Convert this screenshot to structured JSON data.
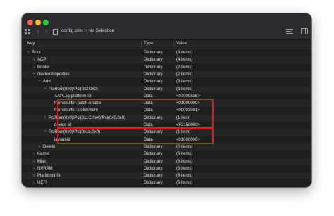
{
  "toolbar": {
    "filename": "config.plist",
    "separator": ">",
    "selection": "No Selection"
  },
  "columns": {
    "key": "Key",
    "type": "Type",
    "value": "Value"
  },
  "rows": [
    {
      "key": "Root",
      "type": "Dictionary",
      "value": "(8 items)",
      "depth": 0,
      "disclosure": "open"
    },
    {
      "key": "ACPI",
      "type": "Dictionary",
      "value": "(4 items)",
      "depth": 1,
      "disclosure": "closed"
    },
    {
      "key": "Booter",
      "type": "Dictionary",
      "value": "(2 items)",
      "depth": 1,
      "disclosure": "closed"
    },
    {
      "key": "DeviceProperties",
      "type": "Dictionary",
      "value": "(2 items)",
      "depth": 1,
      "disclosure": "open"
    },
    {
      "key": "Add",
      "type": "Dictionary",
      "value": "(3 items)",
      "depth": 2,
      "disclosure": "open"
    },
    {
      "key": "PciRoot(0x0)/Pci(0x2,0x0)",
      "type": "Dictionary",
      "value": "(3 items)",
      "depth": 3,
      "disclosure": "open"
    },
    {
      "key": "AAPL,ig-platform-id",
      "type": "Data",
      "value": "<0700983E>",
      "depth": 4,
      "disclosure": ""
    },
    {
      "key": "framebuffer-patch-enable",
      "type": "Data",
      "value": "<01000000>",
      "depth": 4,
      "disclosure": ""
    },
    {
      "key": "framebuffer-stolenmem",
      "type": "Data",
      "value": "<00003001>",
      "depth": 4,
      "disclosure": ""
    },
    {
      "key": "PciRoot(0x0)/Pci(0x1C,0x4)/Pci(0x0,0x0)",
      "type": "Dictionary",
      "value": "(1 item)",
      "depth": 3,
      "disclosure": "open"
    },
    {
      "key": "device-id",
      "type": "Data",
      "value": "<F2150000>",
      "depth": 4,
      "disclosure": ""
    },
    {
      "key": "PciRoot(0x0)/Pci(0x1b,0x0)",
      "type": "Dictionary",
      "value": "(1 item)",
      "depth": 3,
      "disclosure": "open"
    },
    {
      "key": "layout-id",
      "type": "Data",
      "value": "<01000000>",
      "depth": 4,
      "disclosure": ""
    },
    {
      "key": "Delete",
      "type": "Dictionary",
      "value": "(0 items)",
      "depth": 2,
      "disclosure": "closed"
    },
    {
      "key": "Kernel",
      "type": "Dictionary",
      "value": "(6 items)",
      "depth": 1,
      "disclosure": "closed"
    },
    {
      "key": "Misc",
      "type": "Dictionary",
      "value": "(6 items)",
      "depth": 1,
      "disclosure": "closed"
    },
    {
      "key": "NVRAM",
      "type": "Dictionary",
      "value": "(6 items)",
      "depth": 1,
      "disclosure": "closed"
    },
    {
      "key": "PlatformInfo",
      "type": "Dictionary",
      "value": "(6 items)",
      "depth": 1,
      "disclosure": "closed"
    },
    {
      "key": "UEFI",
      "type": "Dictionary",
      "value": "(9 items)",
      "depth": 1,
      "disclosure": "closed"
    }
  ],
  "highlight_color": "#e3172a",
  "icons": {
    "disclosure_open": "⌄",
    "disclosure_closed": "›",
    "back": "‹",
    "forward": "›"
  }
}
